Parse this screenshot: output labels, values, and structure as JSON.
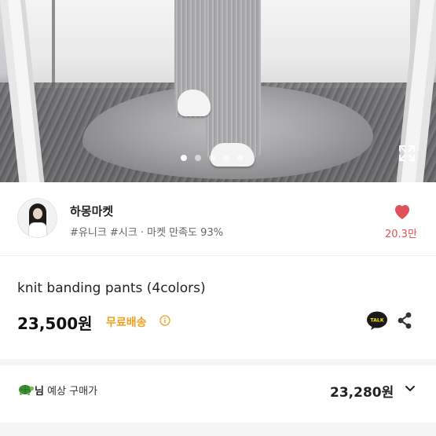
{
  "gallery": {
    "dot_count": 5,
    "active_index": 0,
    "expand_icon": "expand-icon"
  },
  "seller": {
    "name": "하몽마켓",
    "tags": "#유니크 #시크 · 마켓 만족도 93%",
    "like_count": "20.3만",
    "like_color": "#e0505a"
  },
  "product": {
    "title": "knit banding pants (4colors)",
    "price": "23,500원",
    "shipping_badge": "무료배송",
    "shipping_color": "#f0a020",
    "talk_label": "TALK"
  },
  "expected": {
    "suffix": "님",
    "label": "예상 구매가",
    "price": "23,280원"
  }
}
